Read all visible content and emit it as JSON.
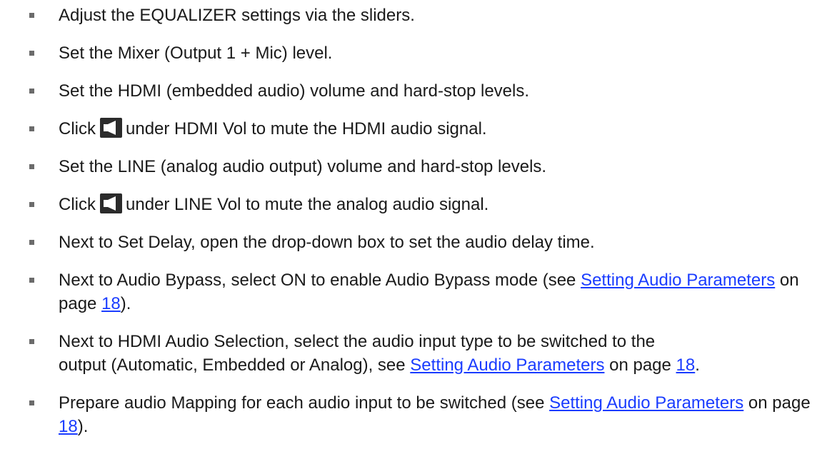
{
  "items": [
    {
      "text": "Adjust the EQUALIZER settings via the sliders."
    },
    {
      "text": "Set the Mixer (Output 1 + Mic) level."
    },
    {
      "text": "Set the HDMI (embedded audio) volume and hard-stop levels."
    },
    {
      "pre": "Click",
      "icon": "speaker-mute-icon",
      "post": "under HDMI Vol to mute the HDMI audio signal."
    },
    {
      "text": "Set the LINE (analog audio output) volume and hard-stop levels."
    },
    {
      "pre": "Click",
      "icon": "speaker-mute-icon",
      "post": "under LINE Vol to mute the analog audio signal."
    },
    {
      "text": "Next to Set Delay, open the drop-down box to set the audio delay time."
    },
    {
      "pre": "Next to Audio Bypass, select ON to enable Audio Bypass mode (see ",
      "link1": "Setting Audio Parameters",
      "mid": " on page ",
      "link2": "18",
      "post": ")."
    },
    {
      "line1": "Next to HDMI Audio Selection, select the audio input type to be switched to the",
      "pre": "output (Automatic, Embedded or Analog), see ",
      "link1": "Setting Audio Parameters",
      "mid": " on page ",
      "link2": "18",
      "post": "."
    },
    {
      "pre": "Prepare audio Mapping for each audio input to be switched (see ",
      "link1": "Setting Audio Parameters",
      "mid": " on page ",
      "link2": "18",
      "post": ")."
    }
  ],
  "colors": {
    "text": "#1a1a1a",
    "link": "#1a3cff",
    "bullet": "#6b6b6b"
  }
}
